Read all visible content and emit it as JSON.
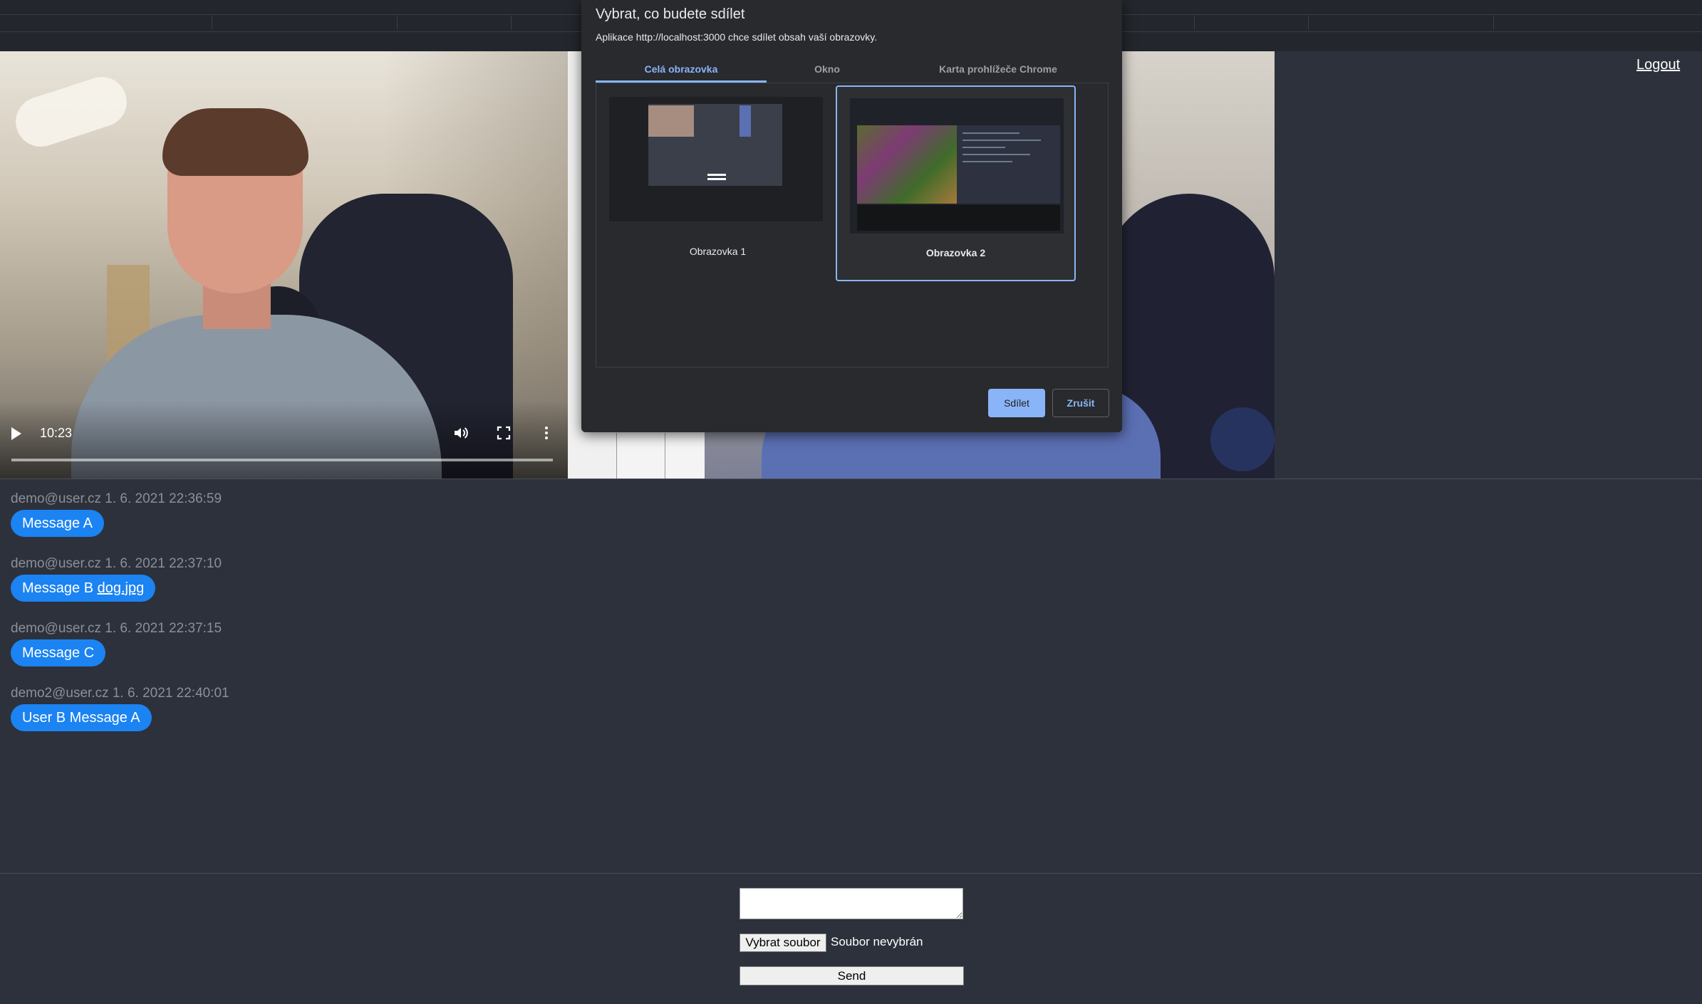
{
  "header": {
    "logout_label": "Logout"
  },
  "video": {
    "time": "10:23",
    "progress": 0.0
  },
  "messages": [
    {
      "author": "demo@user.cz",
      "timestamp": "1. 6. 2021 22:36:59",
      "text": "Message A",
      "attachment": ""
    },
    {
      "author": "demo@user.cz",
      "timestamp": "1. 6. 2021 22:37:10",
      "text": "Message B",
      "attachment": "dog.jpg"
    },
    {
      "author": "demo@user.cz",
      "timestamp": "1. 6. 2021 22:37:15",
      "text": "Message C",
      "attachment": ""
    },
    {
      "author": "demo2@user.cz",
      "timestamp": "1. 6. 2021 22:40:01",
      "text": "User B Message A",
      "attachment": ""
    }
  ],
  "composer": {
    "message_value": "",
    "file_button_label": "Vybrat soubor",
    "file_status": "Soubor nevybrán",
    "send_label": "Send"
  },
  "dialog": {
    "title": "Vybrat, co budete sdílet",
    "subtitle": "Aplikace http://localhost:3000 chce sdílet obsah vaší obrazovky.",
    "tabs": [
      {
        "label": "Celá obrazovka",
        "active": true
      },
      {
        "label": "Okno",
        "active": false
      },
      {
        "label": "Karta prohlížeče Chrome",
        "active": false
      }
    ],
    "screens": [
      {
        "label": "Obrazovka 1",
        "selected": false
      },
      {
        "label": "Obrazovka 2",
        "selected": true
      }
    ],
    "share_label": "Sdílet",
    "cancel_label": "Zrušit"
  },
  "colors": {
    "background": "#2c313c",
    "bubble": "#1b83f2",
    "dialog_bg": "#292a2d",
    "accent": "#8ab4f8"
  },
  "icons": [
    "play-icon",
    "volume-icon",
    "fullscreen-icon",
    "more-vert-icon"
  ]
}
